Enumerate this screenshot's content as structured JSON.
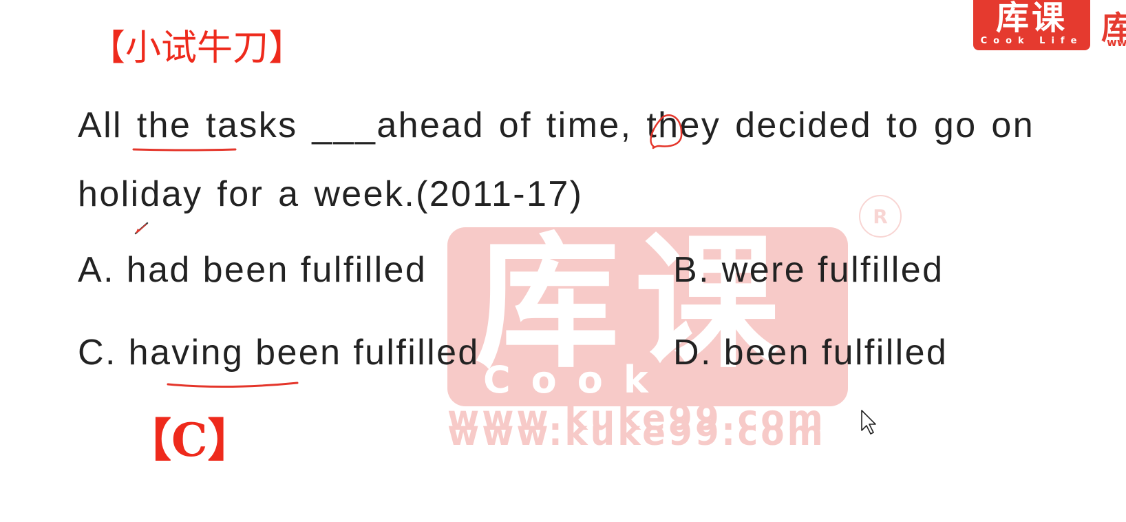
{
  "section_title": "【小试牛刀】",
  "question": "All the tasks ___ahead of time, they decided to go on holiday for a week.(2011-17)",
  "options": [
    {
      "label": "A. had been fulfilled"
    },
    {
      "label": "B. were fulfilled"
    },
    {
      "label": "C. having been fulfilled"
    },
    {
      "label": "D. been fulfilled"
    }
  ],
  "answer": "【C】",
  "logo": {
    "chars": "库课",
    "brand": "Cook Life",
    "partial_char": "库",
    "partial_url": "ww"
  },
  "watermark": {
    "chars": "库课",
    "brand": "Cook Life",
    "url": "www.kuke99.com",
    "reg_mark": "R"
  },
  "colors": {
    "accent": "#ee2a1c",
    "logo_red": "#e53a2f",
    "text": "#222222"
  }
}
